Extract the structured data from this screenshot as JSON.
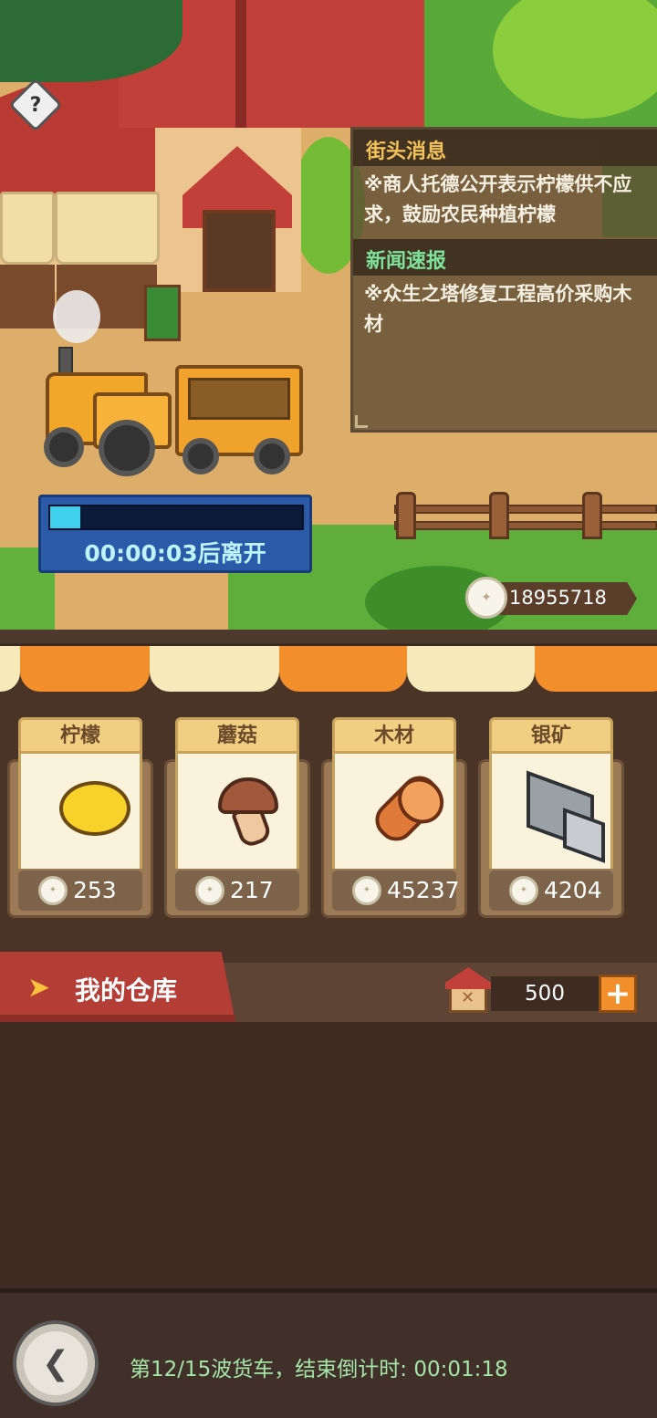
{
  "help": {
    "label": "?"
  },
  "news": {
    "street_title": "街头消息",
    "street_body": "※商人托德公开表示柠檬供不应求，鼓励农民种植柠檬",
    "flash_title": "新闻速报",
    "flash_body": "※众生之塔修复工程高价采购木材"
  },
  "truck_timer": {
    "progress": 0.12,
    "text": "00:00:03后离开"
  },
  "currency": {
    "amount": "18955718",
    "icon": "silver-coin-icon"
  },
  "shop": {
    "items": [
      {
        "name": "柠檬",
        "price": "253",
        "icon": "lemon-icon"
      },
      {
        "name": "蘑菇",
        "price": "217",
        "icon": "mushroom-icon"
      },
      {
        "name": "木材",
        "price": "45237",
        "icon": "wood-log-icon"
      },
      {
        "name": "银矿",
        "price": "4204",
        "icon": "silver-ore-icon"
      }
    ]
  },
  "warehouse": {
    "title": "我的仓库",
    "capacity": "500",
    "add_label": "+"
  },
  "footer": {
    "wave_text": "第12/15波货车，结束倒计时: 00:01:18"
  },
  "colors": {
    "accent_orange": "#f28f2a",
    "tab_red": "#b43d35",
    "news_title": "#f3c35a",
    "news_flash_title": "#7ee39a",
    "timer_fill": "#3fd0ee",
    "footer_text": "#a4e6a8"
  }
}
